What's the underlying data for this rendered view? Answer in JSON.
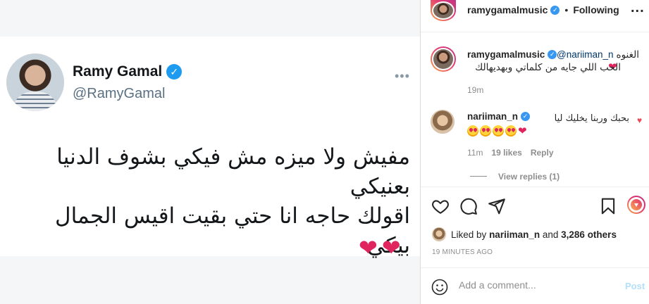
{
  "tweet": {
    "display_name": "Ramy Gamal",
    "handle": "@RamyGamal",
    "more": "•••",
    "lines": [
      "مفيش ولا ميزه مش فيكي بشوف الدنيا بعنيكي",
      "اقولك حاجه انا حتي بقيت اقيس الجمال بيكي"
    ],
    "hearts": [
      "❤",
      "❤"
    ]
  },
  "header": {
    "username": "ramygamalmusic",
    "separator": "•",
    "follow_label": "Following",
    "more": "..."
  },
  "caption": {
    "username": "ramygamalmusic",
    "mention": "@nariiman_n",
    "word": "الغنوه",
    "line2": "الحب اللي جايه من كلماتي وبهديهالك",
    "heart": "❤",
    "time": "19m"
  },
  "comment": {
    "username": "nariiman_n",
    "text": "بحبك وربنا يخليك ليا",
    "heart": "❤",
    "like_icon": "heart-icon",
    "time": "11m",
    "likes": "19 likes",
    "reply": "Reply",
    "view_replies": "View replies (1)"
  },
  "actions": {
    "icons": [
      "heart-icon",
      "comment-icon",
      "share-icon",
      "bookmark-icon",
      "reel-icon"
    ]
  },
  "likes": {
    "prefix": "Liked by",
    "user": "nariiman_n",
    "and": "and",
    "others": "3,286 others"
  },
  "post_time": "19 MINUTES AGO",
  "composer": {
    "placeholder": "Add a comment...",
    "post_label": "Post"
  },
  "colors": {
    "verified_twitter": "#1d9bf0",
    "verified_ig": "#3897f0",
    "heart": "#e0245e",
    "link": "#00376b",
    "muted": "#8e8e8e",
    "post_disabled": "#b2dffc"
  }
}
